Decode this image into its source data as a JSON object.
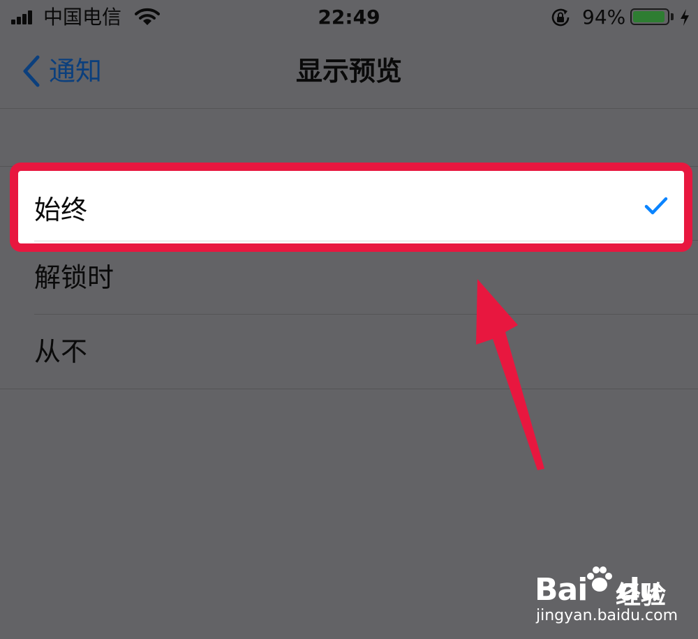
{
  "status_bar": {
    "carrier": "中国电信",
    "time": "22:49",
    "battery_percent": "94%",
    "battery_level": 0.94,
    "battery_color": "#2e7d32"
  },
  "nav": {
    "back_label": "通知",
    "title": "显示预览"
  },
  "options": [
    {
      "label": "始终",
      "selected": true
    },
    {
      "label": "解锁时",
      "selected": false
    },
    {
      "label": "从不",
      "selected": false
    }
  ],
  "colors": {
    "accent": "#0a84ff",
    "highlight": "#e8173f",
    "overlay": "#636366"
  },
  "watermark": {
    "logo": "Bai",
    "logo_tail": "du",
    "brand_cn": "经验",
    "url": "jingyan.baidu.com"
  }
}
